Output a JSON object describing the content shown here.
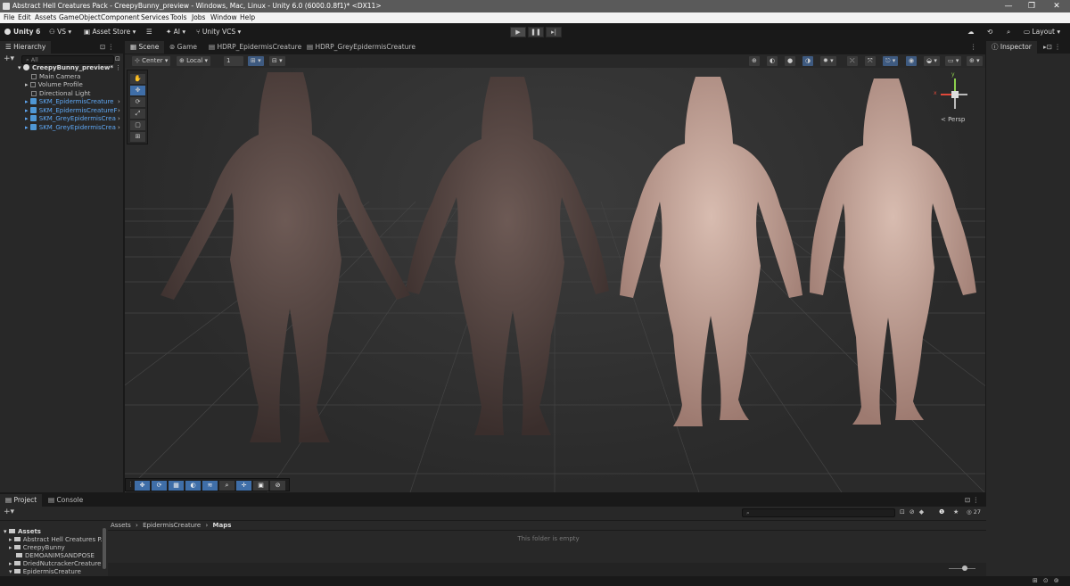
{
  "window": {
    "title": "Abstract Hell Creatures Pack - CreepyBunny_preview - Windows, Mac, Linux - Unity 6.0 (6000.0.8f1)* <DX11>",
    "minimize": "—",
    "maximize": "❐",
    "close": "✕"
  },
  "menu": [
    "File",
    "Edit",
    "Assets",
    "GameObject",
    "Component",
    "Services",
    "Tools",
    "Jobs",
    "Window",
    "Help"
  ],
  "toolbar": {
    "unity": "Unity 6",
    "vs": "VS",
    "asset_store": "Asset Store",
    "ai": "AI",
    "vcs": "Unity VCS",
    "layout": "Layout"
  },
  "hierarchy": {
    "tab": "Hierarchy",
    "search_placeholder": "All",
    "scene": "CreepyBunny_preview*",
    "items": [
      {
        "label": "Main Camera"
      },
      {
        "label": "Volume Profile"
      },
      {
        "label": "Directional Light"
      },
      {
        "label": "SKM_EpidermisCreature"
      },
      {
        "label": "SKM_EpidermisCreatureF"
      },
      {
        "label": "SKM_GreyEpidermisCrea"
      },
      {
        "label": "SKM_GreyEpidermisCrea"
      }
    ]
  },
  "scene_tabs": [
    {
      "label": "Scene"
    },
    {
      "label": "Game"
    },
    {
      "label": "HDRP_EpidermisCreature"
    },
    {
      "label": "HDRP_GreyEpidermisCreature"
    }
  ],
  "scene_bar": {
    "pivot": "Center",
    "space": "Local",
    "snap": "1"
  },
  "gizmo": {
    "persp": "< Persp",
    "x": "x",
    "y": "y"
  },
  "inspector": {
    "tab": "Inspector"
  },
  "project": {
    "tab_project": "Project",
    "tab_console": "Console",
    "breadcrumb": [
      "Assets",
      "EpidermisCreature",
      "Maps"
    ],
    "empty": "This folder is empty",
    "count": "27",
    "tree": [
      {
        "label": "Assets"
      },
      {
        "label": "Abstract Hell Creatures P."
      },
      {
        "label": "CreepyBunny"
      },
      {
        "label": "DEMOANIMSANDPOSE"
      },
      {
        "label": "DriedNutcrackerCreature"
      },
      {
        "label": "EpidermisCreature"
      }
    ]
  },
  "colors": {
    "accent": "#3f6ea8",
    "link": "#5fa8f5",
    "bg": "#282828"
  }
}
